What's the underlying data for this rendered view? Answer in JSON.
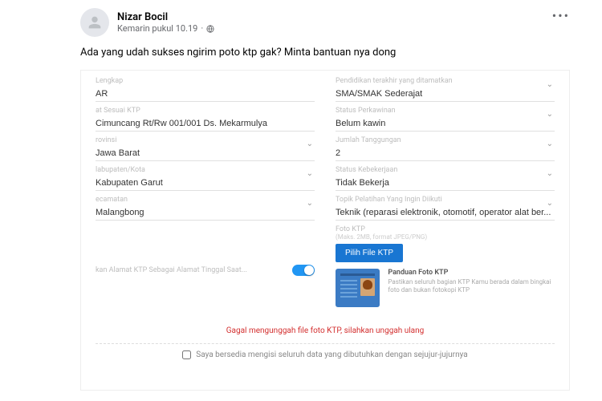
{
  "post": {
    "author": "Nizar Bocil",
    "timestamp": "Kemarin pukul 10.19",
    "privacy_icon": "globe-icon",
    "body": "Ada yang udah sukses ngirim poto ktp gak? Minta bantuan nya dong"
  },
  "form": {
    "left": [
      {
        "label": "Lengkap",
        "value": "AR",
        "type": "text"
      },
      {
        "label": "at Sesuai KTP",
        "value": "Cimuncang Rt/Rw 001/001 Ds. Mekarmulya",
        "type": "text"
      },
      {
        "label": "rovinsi",
        "value": "Jawa Barat",
        "type": "select"
      },
      {
        "label": "labupaten/Kota",
        "value": "Kabupaten Garut",
        "type": "select"
      },
      {
        "label": "ecamatan",
        "value": "Malangbong",
        "type": "select"
      }
    ],
    "right": [
      {
        "label": "Pendidikan terakhir yang ditamatkan",
        "value": "SMA/SMAK Sederajat",
        "type": "select"
      },
      {
        "label": "Status Perkawinan",
        "value": "Belum kawin",
        "type": "select"
      },
      {
        "label": "Jumlah Tanggungan",
        "value": "2",
        "type": "select"
      },
      {
        "label": "Status Kebekerjaan",
        "value": "Tidak Bekerja",
        "type": "select"
      },
      {
        "label": "Topik Pelatihan Yang Ingin Diikuti",
        "value": "Teknik (reparasi elektronik, otomotif, operator alat ber...",
        "type": "select"
      }
    ],
    "toggle": {
      "label": "kan Alamat KTP Sebagai Alamat Tinggal Saat...",
      "on": true
    },
    "ktp": {
      "label": "Foto KTP",
      "sublabel": "(Maks. 2MB, format JPEG/PNG)",
      "button": "Pilih File KTP",
      "panduan_title": "Panduan Foto KTP",
      "panduan_text": "Pastikan seluruh bagian KTP Kamu berada dalam bingkai foto dan bukan fotokopi KTP"
    },
    "error": "Gagal mengunggah file foto KTP, silahkan unggah ulang",
    "consent": "Saya bersedia mengisi seluruh data yang dibutuhkan dengan sejujur-jujurnya"
  }
}
